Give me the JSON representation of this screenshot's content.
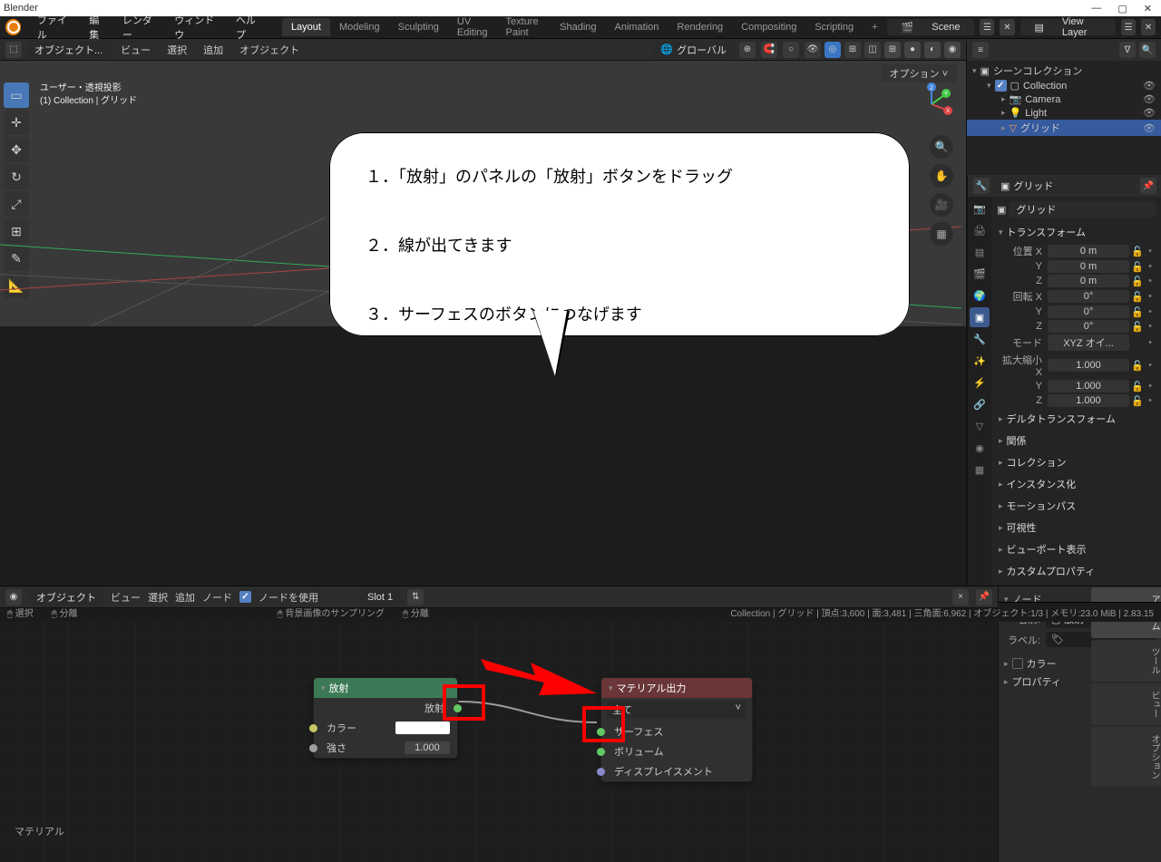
{
  "window": {
    "title": "Blender"
  },
  "menus": {
    "file": "ファイル",
    "edit": "編集",
    "render": "レンダー",
    "window": "ウィンドウ",
    "help": "ヘルプ"
  },
  "tabs": {
    "layout": "Layout",
    "modeling": "Modeling",
    "sculpting": "Sculpting",
    "uv": "UV Editing",
    "texture": "Texture Paint",
    "shading": "Shading",
    "animation": "Animation",
    "rendering": "Rendering",
    "compositing": "Compositing",
    "scripting": "Scripting"
  },
  "topright": {
    "scene": "Scene",
    "viewlayer": "View Layer"
  },
  "vphdr": {
    "mode": "オブジェクト...",
    "view": "ビュー",
    "select": "選択",
    "add": "追加",
    "object": "オブジェクト",
    "globals": "グローバル",
    "options": "オプション"
  },
  "viewport": {
    "line1": "ユーザー・透視投影",
    "line2": "(1) Collection | グリッド"
  },
  "outliner": {
    "scene_collection": "シーンコレクション",
    "collection": "Collection",
    "camera": "Camera",
    "light": "Light",
    "grid": "グリッド"
  },
  "node_editor": {
    "hdr_mode": "オブジェクト",
    "view": "ビュー",
    "select": "選択",
    "add": "追加",
    "node": "ノード",
    "use_nodes": "ノードを使用",
    "slot": "Slot 1",
    "material_label": "マテリアル",
    "node_emit": {
      "title": "放射",
      "out": "放射",
      "color_lbl": "カラー",
      "strength_lbl": "強さ",
      "strength_val": "1.000"
    },
    "node_output": {
      "title": "マテリアル出力",
      "target": "全て",
      "surface": "サーフェス",
      "volume": "ボリューム",
      "disp": "ディスプレイスメント"
    },
    "side": {
      "panel_node": "ノード",
      "name_lbl": "名前:",
      "name_val": "放射",
      "label_lbl": "ラベル:",
      "color_panel": "カラー",
      "prop_panel": "プロパティ",
      "vtab_item": "アイテム",
      "vtab_tool": "ツール",
      "vtab_view": "ビュー",
      "vtab_opt": "オプション"
    }
  },
  "props": {
    "obj": "グリッド",
    "data": "グリッド",
    "transform": "トランスフォーム",
    "loc": "位置",
    "rot": "回転",
    "mode_lbl": "モード",
    "mode_val": "XYZ オイ...",
    "scale": "拡大縮小",
    "vals": {
      "locx": "0 m",
      "locy": "0 m",
      "locz": "0 m",
      "rotx": "0°",
      "roty": "0°",
      "rotz": "0°",
      "sx": "1.000",
      "sy": "1.000",
      "sz": "1.000"
    },
    "axes": {
      "x": "X",
      "y": "Y",
      "z": "Z"
    },
    "delta": "デルタトランスフォーム",
    "relations": "関係",
    "collection": "コレクション",
    "instancing": "インスタンス化",
    "motion": "モーションパス",
    "visibility": "可視性",
    "vp_display": "ビューポート表示",
    "custom": "カスタムプロパティ"
  },
  "callout": {
    "l1": "１．「放射」のパネルの「放射」ボタンをドラッグ",
    "l2": "２．線が出てきます",
    "l3": "３．サーフェスのボタンにつなげます"
  },
  "status": {
    "left1": "選択",
    "left2": "分離",
    "mid1": "背景画像のサンプリング",
    "mid2": "分離",
    "right": "Collection | グリッド | 頂点:3,600 | 面:3,481 | 三角面:6,962 | オブジェクト:1/3 | メモリ:23.0 MiB | 2.83.15"
  }
}
